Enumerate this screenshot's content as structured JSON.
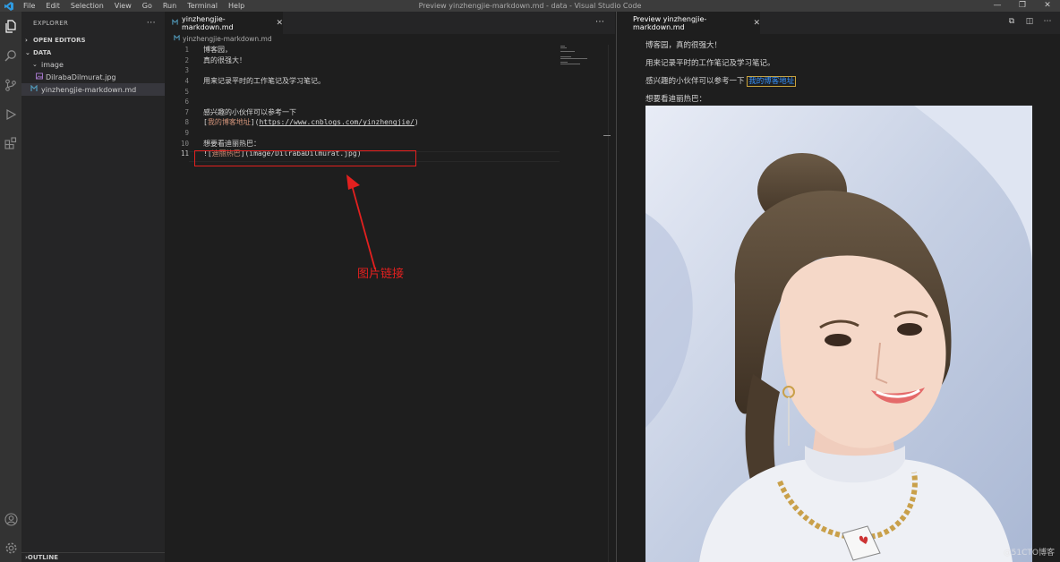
{
  "titlebar": {
    "menu": [
      "File",
      "Edit",
      "Selection",
      "View",
      "Go",
      "Run",
      "Terminal",
      "Help"
    ],
    "title": "Preview yinzhengjie-markdown.md - data - Visual Studio Code",
    "controls": [
      "—",
      "❐",
      "✕"
    ]
  },
  "activity_icons": [
    "files-icon",
    "search-icon",
    "source-control-icon",
    "run-debug-icon",
    "extensions-icon",
    "account-icon",
    "settings-gear-icon"
  ],
  "sidebar": {
    "header": "EXPLORER",
    "open_editors": "OPEN EDITORS",
    "folder": "DATA",
    "items": [
      {
        "label": "image",
        "indent": 1,
        "kind": "folder"
      },
      {
        "label": "DilrabaDilmurat.jpg",
        "indent": 2,
        "kind": "image"
      },
      {
        "label": "yinzhengjie-markdown.md",
        "indent": 1,
        "kind": "markdown"
      }
    ],
    "outline": "OUTLINE"
  },
  "editor": {
    "tab": "yinzhengjie-markdown.md",
    "breadcrumb": "yinzhengjie-markdown.md",
    "lines": [
      {
        "n": "1",
        "text": "博客园，"
      },
      {
        "n": "2",
        "text": "真的很强大！"
      },
      {
        "n": "3",
        "text": ""
      },
      {
        "n": "4",
        "text": "用来记录平时的工作笔记及学习笔记。"
      },
      {
        "n": "5",
        "text": ""
      },
      {
        "n": "6",
        "text": ""
      },
      {
        "n": "7",
        "text": "感兴趣的小伙伴可以参考一下"
      },
      {
        "n": "8",
        "text": "",
        "link_open": "[",
        "link_text": "我的博客地址",
        "link_mid": "](",
        "link_url": "https://www.cnblogs.com/yinzhengjie/",
        "link_close": ")"
      },
      {
        "n": "9",
        "text": ""
      },
      {
        "n": "10",
        "text": "想要看迪丽热巴："
      },
      {
        "n": "11",
        "text": "",
        "link_open": "![",
        "link_text": "迪丽热巴",
        "link_mid": "](",
        "link_url": "image/DilrabaDilmurat.jpg",
        "link_close": ")"
      }
    ],
    "annotation": "图片链接"
  },
  "preview": {
    "tab": "Preview yinzhengjie-markdown.md",
    "p1": "博客园，真的很强大！",
    "p2": "用来记录平时的工作笔记及学习笔记。",
    "p3_text": "感兴趣的小伙伴可以参考一下",
    "p3_link": "我的博客地址",
    "p4": "想要看迪丽热巴：",
    "watermark": "@51CTO博客"
  },
  "colors": {
    "accent_red": "#e3201f",
    "link_blue": "#3794ff"
  }
}
